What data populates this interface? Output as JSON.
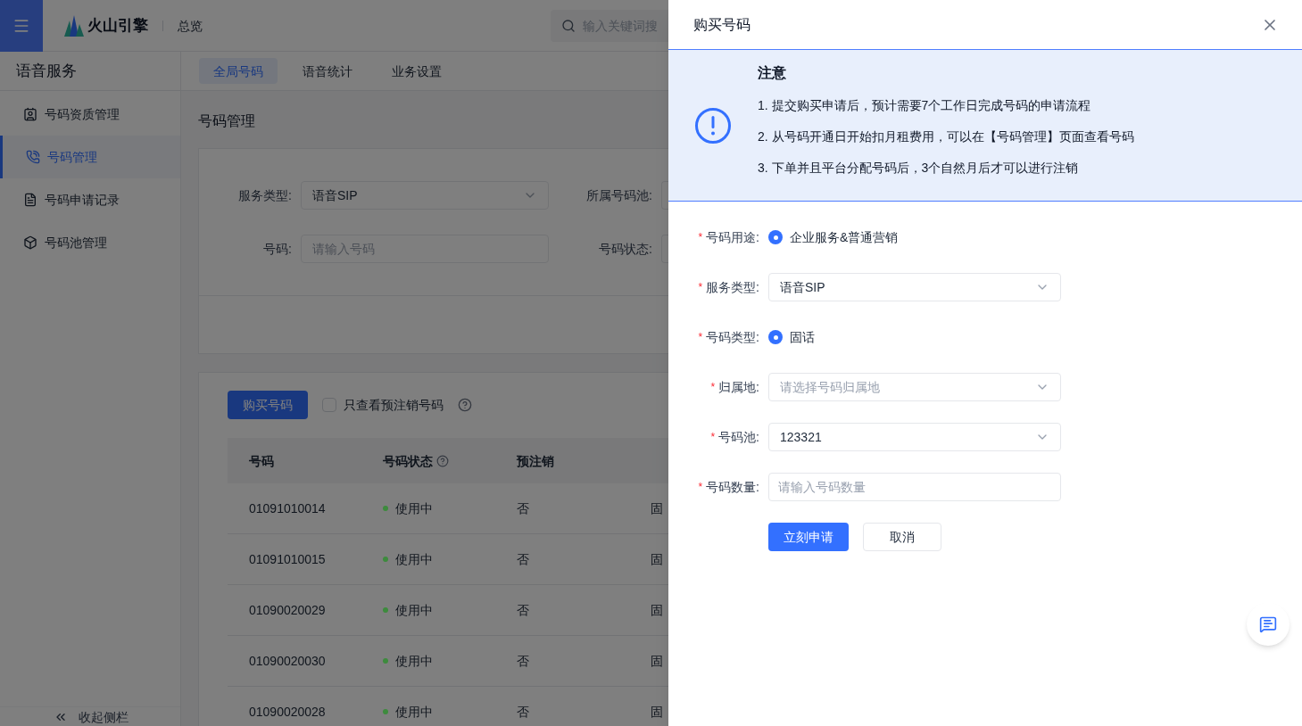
{
  "header": {
    "logo_text": "火山引擎",
    "nav": "总览",
    "search_placeholder": "输入关键词搜"
  },
  "sidebar": {
    "title": "语音服务",
    "items": [
      {
        "label": "号码资质管理",
        "selected": false
      },
      {
        "label": "号码管理",
        "selected": true
      },
      {
        "label": "号码申请记录",
        "selected": false
      },
      {
        "label": "号码池管理",
        "selected": false
      }
    ],
    "collapse": "收起侧栏"
  },
  "tabs": [
    {
      "label": "全局号码",
      "selected": true
    },
    {
      "label": "语音统计",
      "selected": false
    },
    {
      "label": "业务设置",
      "selected": false
    }
  ],
  "page_title": "号码管理",
  "filters": [
    {
      "label": "服务类型:",
      "kind": "select",
      "value": "语音SIP"
    },
    {
      "label": "所属号码池:",
      "kind": "cut"
    },
    {
      "label": "号码:",
      "kind": "input",
      "placeholder": "请输入号码"
    },
    {
      "label": "号码状态:",
      "kind": "cut"
    }
  ],
  "toolbar": {
    "buy_button": "购买号码",
    "checkbox": {
      "label": "只查看预注销号码",
      "checked": false
    }
  },
  "table": {
    "columns": [
      {
        "label": "号码",
        "help": false
      },
      {
        "label": "号码状态",
        "help": true
      },
      {
        "label": "预注销",
        "help": false
      }
    ],
    "rows": [
      {
        "number": "01091010014",
        "status": "使用中",
        "color": "#3d8b3d",
        "pre_cancel": "否",
        "column_4": "固"
      },
      {
        "number": "01091010015",
        "status": "使用中",
        "color": "#3d8b3d",
        "pre_cancel": "否",
        "column_4": "固"
      },
      {
        "number": "01090020029",
        "status": "使用中",
        "color": "#3d8b3d",
        "pre_cancel": "否",
        "column_4": "固"
      },
      {
        "number": "01090020030",
        "status": "使用中",
        "color": "#3d8b3d",
        "pre_cancel": "否",
        "column_4": "固"
      },
      {
        "number": "01090020028",
        "status": "使用中",
        "color": "#3d8b3d",
        "pre_cancel": "否",
        "column_4": "固"
      }
    ]
  },
  "drawer": {
    "title": "购买号码",
    "notice": {
      "title": "注意",
      "lines": [
        "1. 提交购买申请后，预计需要7个工作日完成号码的申请流程",
        "2. 从号码开通日开始扣月租费用，可以在【号码管理】页面查看号码",
        "3. 下单并且平台分配号码后，3个自然月后才可以进行注销"
      ]
    },
    "form": [
      {
        "mark": "*",
        "label": "号码用途:",
        "kind": "radio",
        "options": [
          {
            "label": "企业服务&普通营销",
            "selected": true
          }
        ]
      },
      {
        "mark": "*",
        "label": "服务类型:",
        "kind": "select",
        "value": "语音SIP"
      },
      {
        "mark": "*",
        "label": "号码类型:",
        "kind": "radio",
        "options": [
          {
            "label": "固话",
            "selected": true
          }
        ]
      },
      {
        "mark": "*",
        "label": "归属地:",
        "kind": "select",
        "placeholder": "请选择号码归属地"
      },
      {
        "mark": "*",
        "label": "号码池:",
        "kind": "select",
        "value": "123321"
      },
      {
        "mark": "*",
        "label": "号码数量:",
        "kind": "input",
        "placeholder": "请输入号码数量"
      }
    ],
    "buttons": [
      {
        "label": "立刻申请",
        "kind": "primary"
      },
      {
        "label": "取消",
        "kind": "default"
      }
    ]
  }
}
